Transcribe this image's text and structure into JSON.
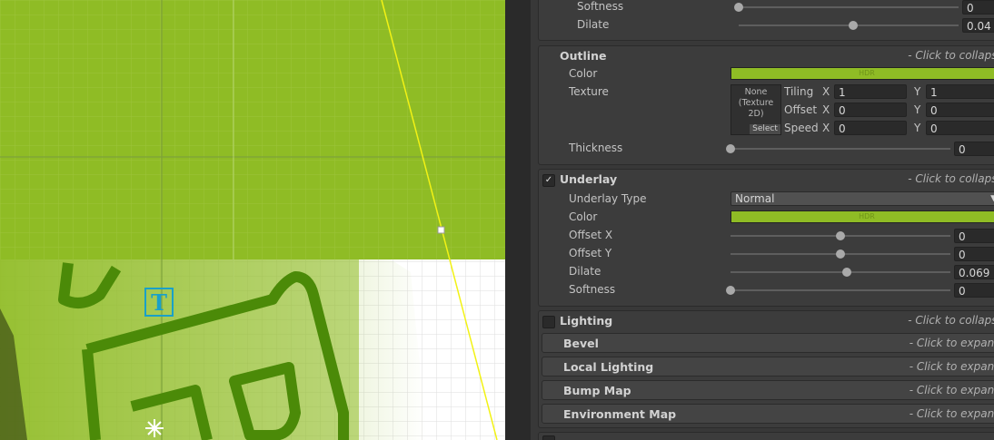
{
  "scene": {
    "tool_icon_letter": "T"
  },
  "face": {
    "softness": {
      "label": "Softness",
      "value": "0",
      "level": 0.0
    },
    "dilate": {
      "label": "Dilate",
      "value": "0.04",
      "level": 0.52
    }
  },
  "outline": {
    "title": "Outline",
    "hint": "- Click to collapse -",
    "color_label": "Color",
    "hdr": "HDR",
    "texture_label": "Texture",
    "texture_thumb_lines": [
      "None",
      "(Texture",
      "2D)"
    ],
    "texture_select": "Select",
    "tiling": {
      "label": "Tiling",
      "x_label": "X",
      "x": "1",
      "y_label": "Y",
      "y": "1"
    },
    "offset": {
      "label": "Offset",
      "x_label": "X",
      "x": "0",
      "y_label": "Y",
      "y": "0"
    },
    "speed": {
      "label": "Speed",
      "x_label": "X",
      "x": "0",
      "y_label": "Y",
      "y": "0"
    },
    "thickness": {
      "label": "Thickness",
      "value": "0",
      "level": 0.0
    }
  },
  "underlay": {
    "title": "Underlay",
    "checked": "✓",
    "hint": "- Click to collapse -",
    "type_label": "Underlay Type",
    "type_value": "Normal",
    "color_label": "Color",
    "hdr": "HDR",
    "offset_x": {
      "label": "Offset X",
      "value": "0",
      "level": 0.5
    },
    "offset_y": {
      "label": "Offset Y",
      "value": "0",
      "level": 0.5
    },
    "dilate": {
      "label": "Dilate",
      "value": "0.069",
      "level": 0.53
    },
    "softness": {
      "label": "Softness",
      "value": "0",
      "level": 0.0
    }
  },
  "lighting": {
    "title": "Lighting",
    "hint": "- Click to collapse -",
    "bevel": {
      "title": "Bevel",
      "hint": "- Click to expand -"
    },
    "local_lighting": {
      "title": "Local Lighting",
      "hint": "- Click to expand -"
    },
    "bump_map": {
      "title": "Bump Map",
      "hint": "- Click to expand -"
    },
    "environment_map": {
      "title": "Environment Map",
      "hint": "- Click to expand -"
    }
  },
  "colors": {
    "green": "#8fbc25",
    "dark_green": "#4b8a08",
    "panel": "#383838"
  }
}
